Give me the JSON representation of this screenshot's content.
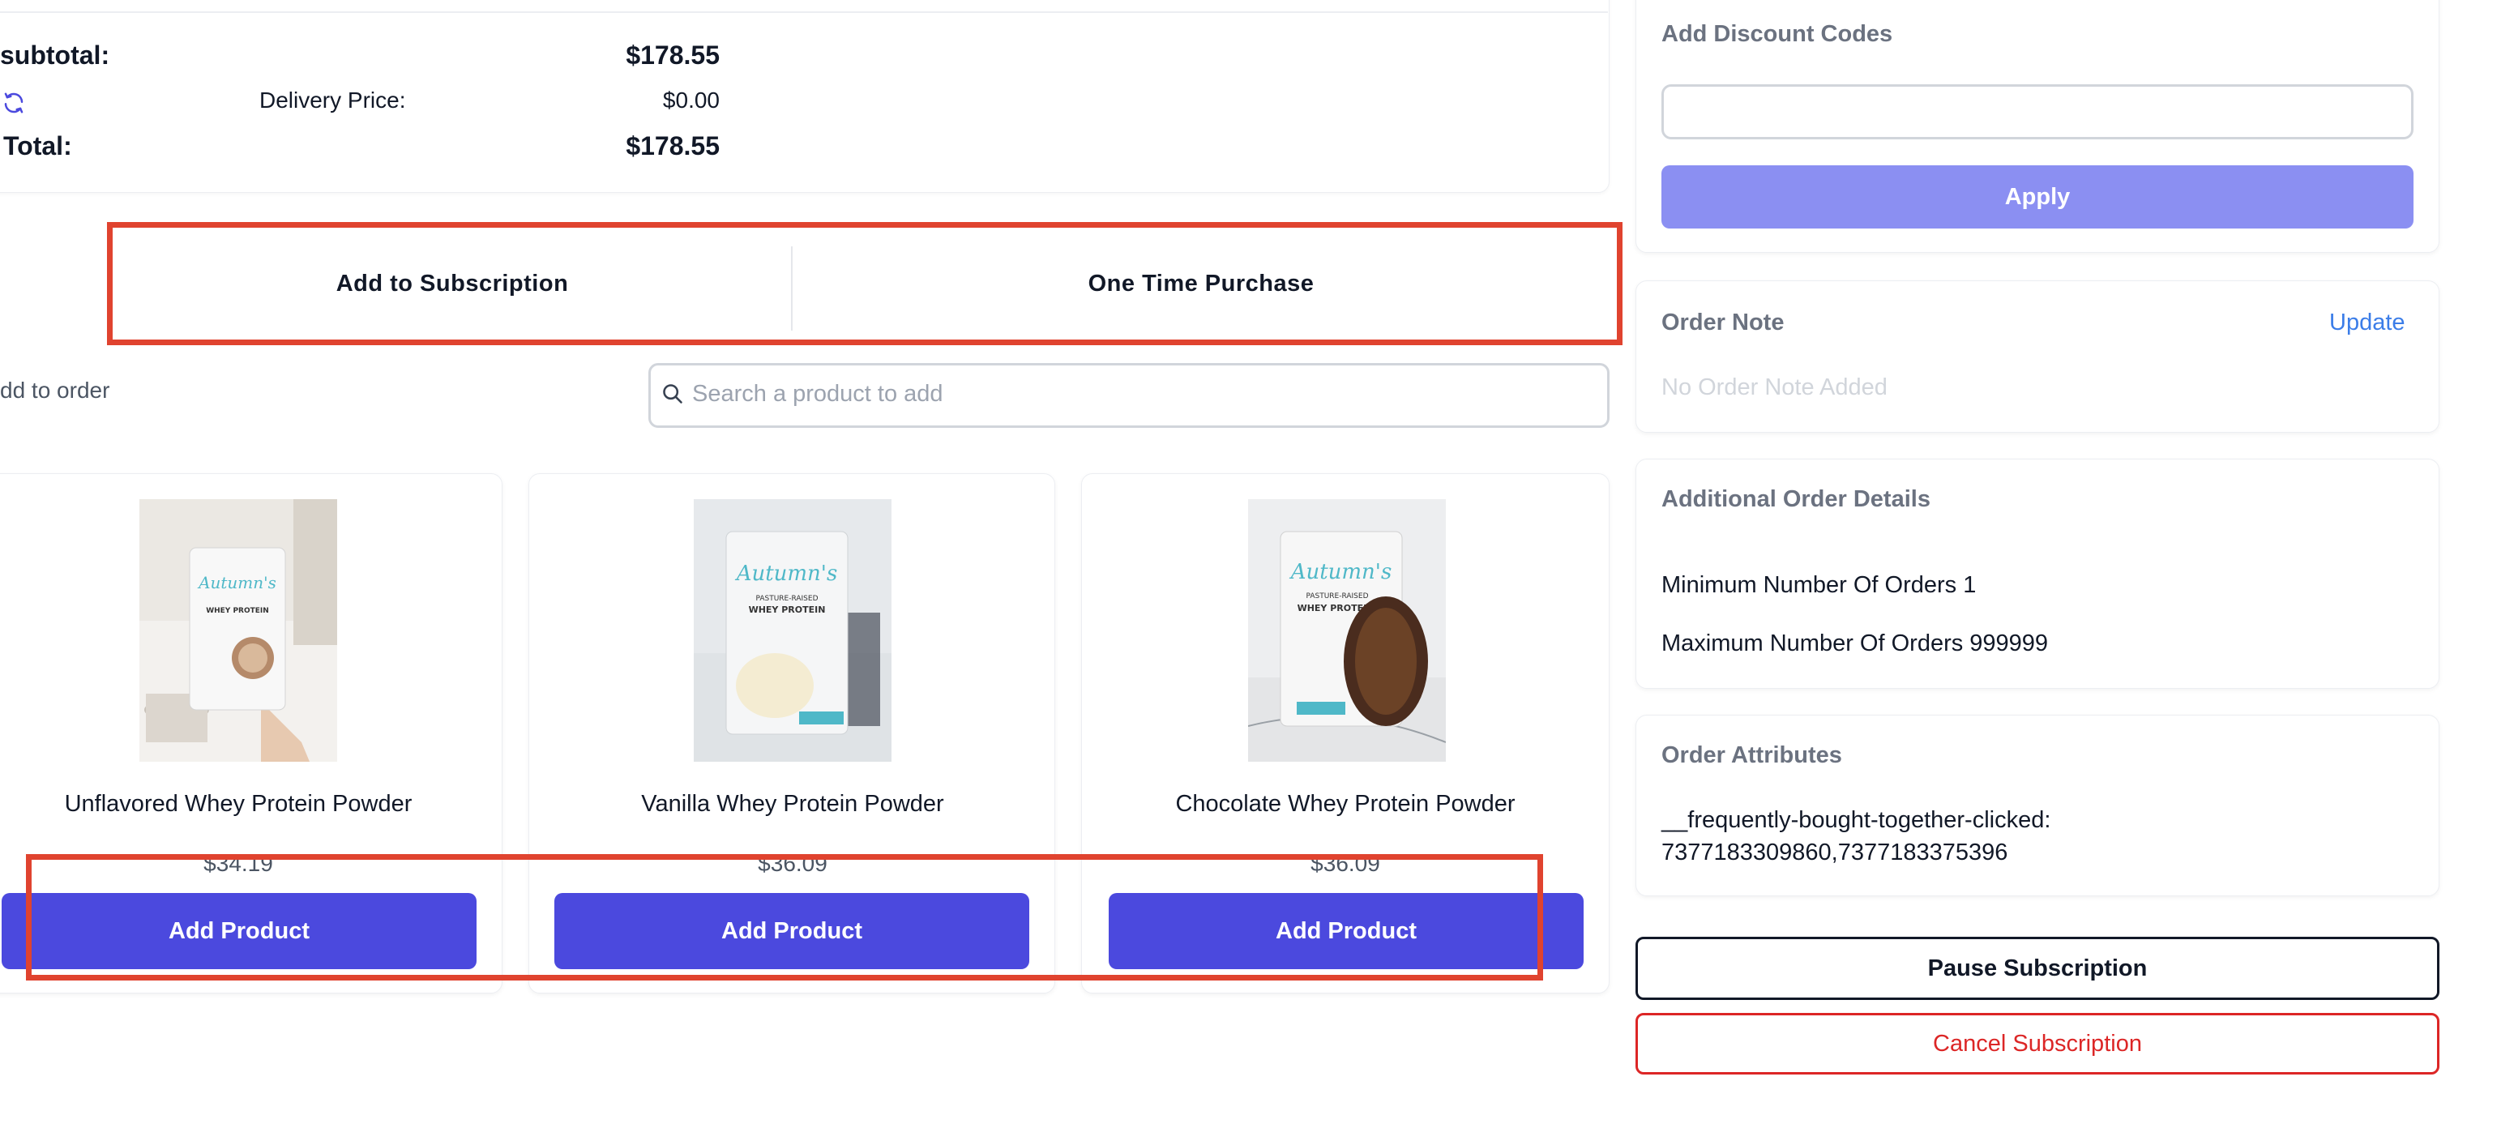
{
  "summary": {
    "subtotal_label": "subtotal:",
    "subtotal_value": "$178.55",
    "delivery_label": "Delivery Price:",
    "delivery_value": "$0.00",
    "total_label": "Total:",
    "total_value": "$178.55"
  },
  "purchase_options": {
    "subscription_label": "Add to Subscription",
    "one_time_label": "One Time Purchase"
  },
  "add_to_order": {
    "label": "dd to order",
    "search_placeholder": "Search a product to add"
  },
  "products": [
    {
      "name": "Unflavored Whey Protein Powder",
      "price": "$34.19",
      "button_label": "Add Product"
    },
    {
      "name": "Vanilla Whey Protein Powder",
      "price": "$36.09",
      "button_label": "Add Product"
    },
    {
      "name": "Chocolate Whey Protein Powder",
      "price": "$36.09",
      "button_label": "Add Product"
    }
  ],
  "product_image_text": {
    "brand": "Autumn's",
    "line1": "PASTURE-RAISED",
    "line2": "WHEY PROTEIN"
  },
  "sidebar": {
    "discount": {
      "title": "Add Discount Codes",
      "input_value": "",
      "apply_label": "Apply"
    },
    "order_note": {
      "title": "Order Note",
      "update_label": "Update",
      "empty_text": "No Order Note Added"
    },
    "additional_details": {
      "title": "Additional Order Details",
      "min_orders": "Minimum Number Of Orders 1",
      "max_orders": "Maximum Number Of Orders 999999"
    },
    "order_attributes": {
      "title": "Order Attributes",
      "key": "__frequently-bought-together-clicked:",
      "value": "7377183309860,7377183375396"
    },
    "pause_label": "Pause Subscription",
    "cancel_label": "Cancel Subscription"
  },
  "colors": {
    "accent": "#4b49de",
    "accent_disabled": "#8b8ff2",
    "highlight": "#e0432f",
    "danger": "#dc2626",
    "link": "#3b7de8"
  },
  "icons": {
    "refresh": "refresh-icon",
    "search": "search-icon"
  }
}
